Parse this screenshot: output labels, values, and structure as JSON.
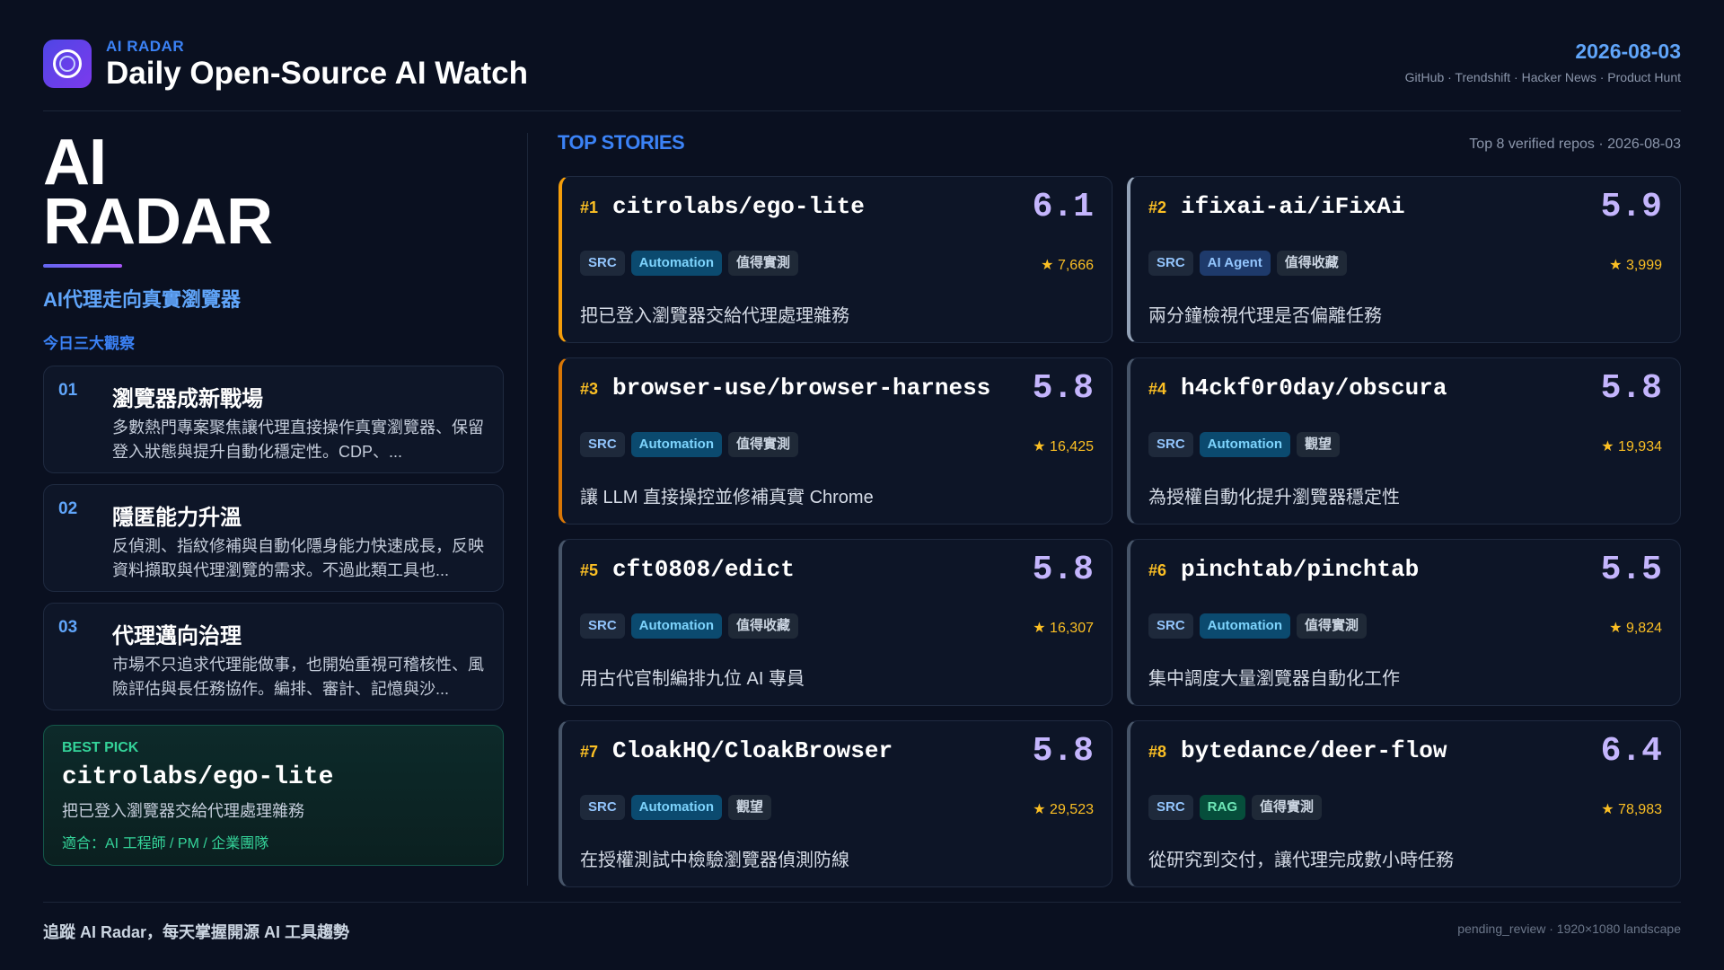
{
  "header": {
    "kicker": "AI RADAR",
    "title": "Daily Open-Source AI Watch",
    "date": "2026-08-03",
    "sources": "GitHub · Trendshift · Hacker News · Product Hunt"
  },
  "left": {
    "hero_line1": "AI",
    "hero_line2": "RADAR",
    "subtitle": "AI代理走向真實瀏覽器",
    "observations_label": "今日三大觀察",
    "observations": [
      {
        "num": "01",
        "title": "瀏覽器成新戰場",
        "desc": "多數熱門專案聚焦讓代理直接操作真實瀏覽器、保留登入狀態與提升自動化穩定性。CDP、..."
      },
      {
        "num": "02",
        "title": "隱匿能力升溫",
        "desc": "反偵測、指紋修補與自動化隱身能力快速成長，反映資料擷取與代理瀏覽的需求。不過此類工具也..."
      },
      {
        "num": "03",
        "title": "代理邁向治理",
        "desc": "市場不只追求代理能做事，也開始重視可稽核性、風險評估與長任務協作。編排、審計、記憶與沙..."
      }
    ],
    "best_pick": {
      "kicker": "BEST PICK",
      "repo": "citrolabs/ego-lite",
      "desc": "把已登入瀏覽器交給代理處理雜務",
      "fit": "適合：AI 工程師 / PM / 企業團隊"
    }
  },
  "top": {
    "title": "TOP STORIES",
    "meta": "Top 8 verified repos · 2026-08-03",
    "stories": [
      {
        "rank": "#1",
        "repo": "citrolabs/ego-lite",
        "score": "6.1",
        "src": "SRC",
        "category": "Automation",
        "verdict": "值得實測",
        "stars": "★ 7,666",
        "desc": "把已登入瀏覽器交給代理處理雜務"
      },
      {
        "rank": "#2",
        "repo": "ifixai-ai/iFixAi",
        "score": "5.9",
        "src": "SRC",
        "category": "AI Agent",
        "verdict": "值得收藏",
        "stars": "★ 3,999",
        "desc": "兩分鐘檢視代理是否偏離任務"
      },
      {
        "rank": "#3",
        "repo": "browser-use/browser-harness",
        "score": "5.8",
        "src": "SRC",
        "category": "Automation",
        "verdict": "值得實測",
        "stars": "★ 16,425",
        "desc": "讓 LLM 直接操控並修補真實 Chrome"
      },
      {
        "rank": "#4",
        "repo": "h4ckf0r0day/obscura",
        "score": "5.8",
        "src": "SRC",
        "category": "Automation",
        "verdict": "觀望",
        "stars": "★ 19,934",
        "desc": "為授權自動化提升瀏覽器穩定性"
      },
      {
        "rank": "#5",
        "repo": "cft0808/edict",
        "score": "5.8",
        "src": "SRC",
        "category": "Automation",
        "verdict": "值得收藏",
        "stars": "★ 16,307",
        "desc": "用古代官制編排九位 AI 專員"
      },
      {
        "rank": "#6",
        "repo": "pinchtab/pinchtab",
        "score": "5.5",
        "src": "SRC",
        "category": "Automation",
        "verdict": "值得實測",
        "stars": "★ 9,824",
        "desc": "集中調度大量瀏覽器自動化工作"
      },
      {
        "rank": "#7",
        "repo": "CloakHQ/CloakBrowser",
        "score": "5.8",
        "src": "SRC",
        "category": "Automation",
        "verdict": "觀望",
        "stars": "★ 29,523",
        "desc": "在授權測試中檢驗瀏覽器偵測防線"
      },
      {
        "rank": "#8",
        "repo": "bytedance/deer-flow",
        "score": "6.4",
        "src": "SRC",
        "category": "RAG",
        "verdict": "值得實測",
        "stars": "★ 78,983",
        "desc": "從研究到交付，讓代理完成數小時任務"
      }
    ]
  },
  "footer": {
    "left": "追蹤 AI Radar，每天掌握開源 AI 工具趨勢",
    "right": "pending_review · 1920×1080 landscape"
  },
  "colors": {
    "background": "#0a1020",
    "accent_blue": "#3b82f6",
    "score_purple": "#c4b5fd",
    "rank_gold": "#fbbf24",
    "best_green": "#34d399"
  }
}
